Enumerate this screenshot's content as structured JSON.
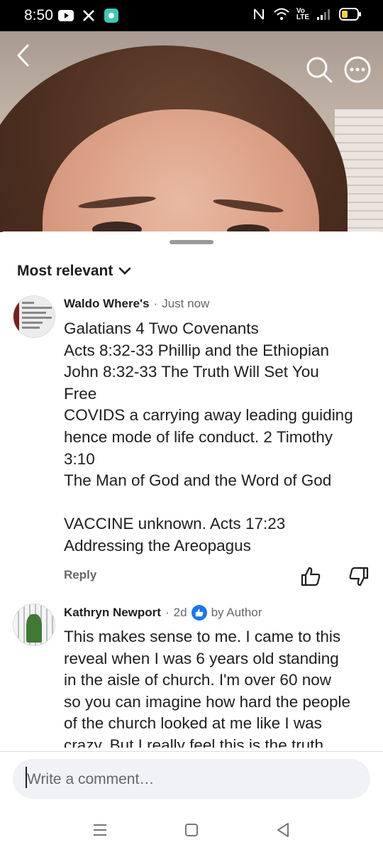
{
  "status_bar": {
    "time": "8:50",
    "network_label_top": "Vo",
    "network_label_bottom": "LTE"
  },
  "icons": {
    "back": "chevron-left-icon",
    "search": "search-icon",
    "more": "more-options-icon",
    "sort_caret": "chevron-down-icon",
    "like": "thumbs-up-icon",
    "dislike": "thumbs-down-icon",
    "verified": "like-badge-icon"
  },
  "sort": {
    "label": "Most relevant"
  },
  "comments": [
    {
      "author": "Waldo Where's",
      "time": "Just now",
      "lines": [
        "Galatians 4 Two Covenants",
        "Acts 8:32-33 Phillip and the Ethiopian",
        "John 8:32-33 The Truth Will Set You",
        "Free",
        "COVIDS a carrying away leading guiding",
        "hence mode of life conduct. 2 Timothy",
        "3:10",
        "The Man of God and the Word of God",
        "",
        "VACCINE unknown. Acts 17:23",
        "Addressing the Areopagus"
      ],
      "reply_label": "Reply"
    },
    {
      "author": "Kathryn Newport",
      "time": "2d",
      "badge_label": "by Author",
      "lines": [
        "This makes sense to me. I came to this",
        "reveal when I was 6 years old standing",
        "in the aisle of church. I'm over 60 now",
        "so you can imagine how hard the people",
        "of the church looked at me like I was",
        "crazy. But I really feel this is the truth."
      ]
    }
  ],
  "composer": {
    "placeholder": "Write a comment…"
  },
  "colors": {
    "accent": "#1877f2",
    "muted": "#65676b",
    "status_bar": "#000000"
  }
}
